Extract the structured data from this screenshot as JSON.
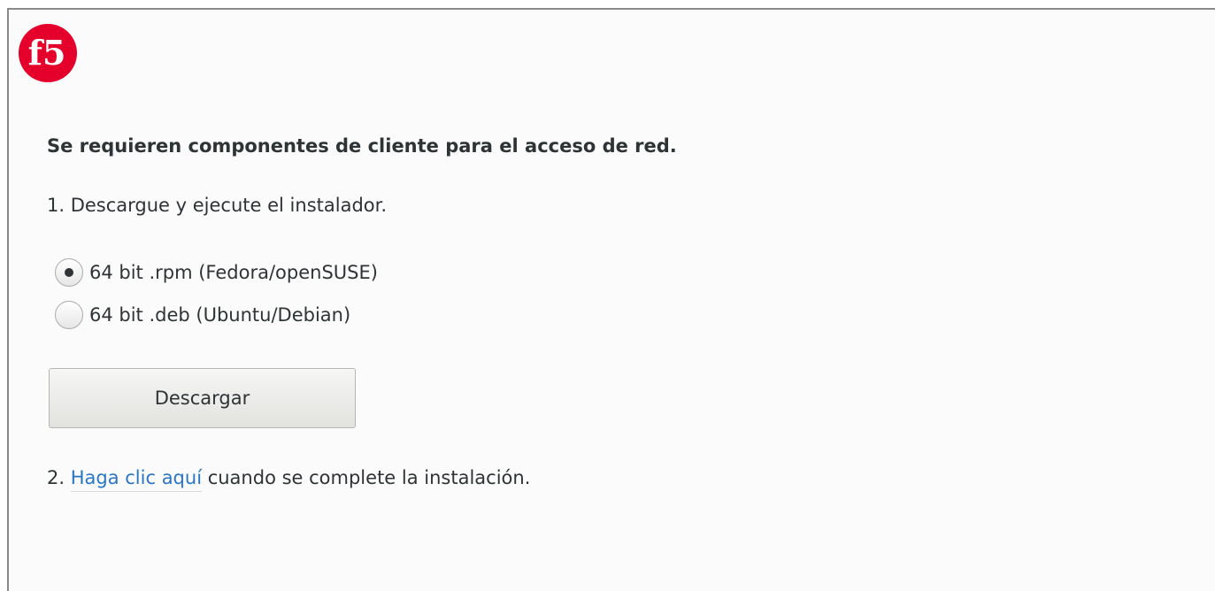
{
  "brand": {
    "logo_text": "f5",
    "logo_icon": "f5-logo-icon",
    "logo_color": "#e4002b"
  },
  "title": "Se requieren componentes de cliente para el acceso de red.",
  "step1": "1. Descargue y ejecute el instalador.",
  "installer_options": [
    {
      "label": "64 bit .rpm (Fedora/openSUSE)",
      "selected": true
    },
    {
      "label": "64 bit .deb (Ubuntu/Debian)",
      "selected": false
    }
  ],
  "download_button": "Descargar",
  "step2": {
    "prefix": "2. ",
    "link": "Haga clic aquí",
    "suffix": " cuando se complete la instalación."
  },
  "colors": {
    "link": "#2a76c6",
    "text": "#2e3436"
  }
}
